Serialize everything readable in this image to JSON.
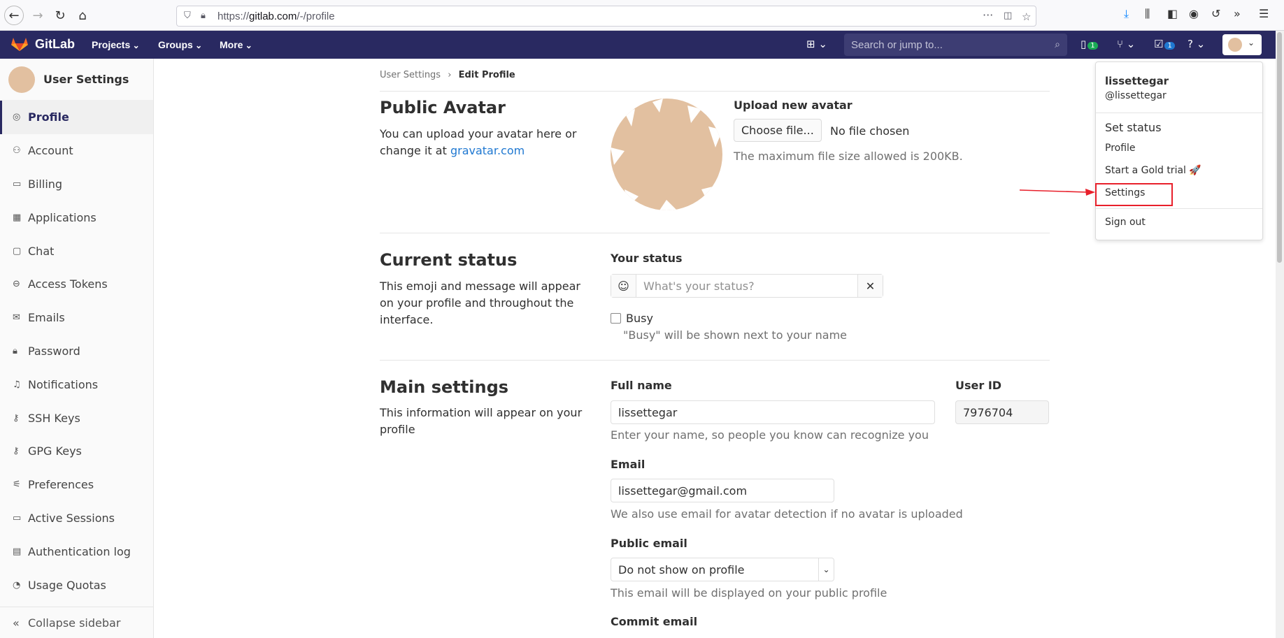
{
  "browser": {
    "url_prefix": "https://",
    "url_host": "gitlab.com",
    "url_path": "/-/profile"
  },
  "header": {
    "brand": "GitLab",
    "nav": [
      "Projects",
      "Groups",
      "More"
    ],
    "search_placeholder": "Search or jump to...",
    "issues_count": "1",
    "todos_count": "1"
  },
  "sidebar": {
    "title": "User Settings",
    "items": [
      {
        "label": "Profile",
        "icon": "profile-icon",
        "active": true
      },
      {
        "label": "Account",
        "icon": "account-icon"
      },
      {
        "label": "Billing",
        "icon": "billing-icon"
      },
      {
        "label": "Applications",
        "icon": "applications-icon"
      },
      {
        "label": "Chat",
        "icon": "chat-icon"
      },
      {
        "label": "Access Tokens",
        "icon": "token-icon"
      },
      {
        "label": "Emails",
        "icon": "email-icon"
      },
      {
        "label": "Password",
        "icon": "lock-icon"
      },
      {
        "label": "Notifications",
        "icon": "bell-icon"
      },
      {
        "label": "SSH Keys",
        "icon": "key-icon"
      },
      {
        "label": "GPG Keys",
        "icon": "key-icon"
      },
      {
        "label": "Preferences",
        "icon": "preferences-icon"
      },
      {
        "label": "Active Sessions",
        "icon": "monitor-icon"
      },
      {
        "label": "Authentication log",
        "icon": "log-icon"
      },
      {
        "label": "Usage Quotas",
        "icon": "quota-icon"
      }
    ],
    "collapse": "Collapse sidebar"
  },
  "breadcrumb": {
    "parent": "User Settings",
    "current": "Edit Profile"
  },
  "avatar_section": {
    "title": "Public Avatar",
    "desc": "You can upload your avatar here or change it at",
    "link": "gravatar.com",
    "upload_label": "Upload new avatar",
    "choose_button": "Choose file...",
    "no_file": "No file chosen",
    "max_size": "The maximum file size allowed is 200KB."
  },
  "status_section": {
    "title": "Current status",
    "desc": "This emoji and message will appear on your profile and throughout the interface.",
    "your_status": "Your status",
    "placeholder": "What's your status?",
    "busy_label": "Busy",
    "busy_help": "\"Busy\" will be shown next to your name"
  },
  "main_section": {
    "title": "Main settings",
    "desc": "This information will appear on your profile",
    "full_name_label": "Full name",
    "full_name": "lissettegar",
    "full_name_help": "Enter your name, so people you know can recognize you",
    "user_id_label": "User ID",
    "user_id": "7976704",
    "email_label": "Email",
    "email": "lissettegar@gmail.com",
    "email_help": "We also use email for avatar detection if no avatar is uploaded",
    "public_email_label": "Public email",
    "public_email": "Do not show on profile",
    "public_email_help": "This email will be displayed on your public profile",
    "commit_email_label": "Commit email"
  },
  "dropdown": {
    "name": "lissettegar",
    "handle": "@lissettegar",
    "set_status": "Set status",
    "profile": "Profile",
    "gold_trial": "Start a Gold trial 🚀",
    "settings": "Settings",
    "sign_out": "Sign out"
  },
  "colors": {
    "header": "#292961",
    "link": "#1f78d1",
    "annotation": "#e8202b"
  }
}
